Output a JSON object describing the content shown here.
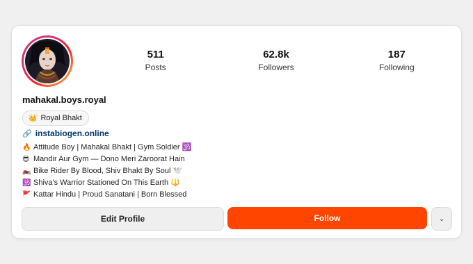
{
  "profile": {
    "username": "mahakal.boys.royal",
    "badge": {
      "icon": "crown-icon",
      "glyph": "👑",
      "label": "Royal Bhakt"
    },
    "link": {
      "icon": "link-icon",
      "glyph": "🔗",
      "text": "instabiogen.online"
    },
    "avatar": {
      "icon": "profile-avatar",
      "ring_colors": [
        "#c13584",
        "#fd1d1d",
        "#fcaf45"
      ]
    }
  },
  "stats": [
    {
      "value": "511",
      "label": "Posts"
    },
    {
      "value": "62.8k",
      "label": "Followers"
    },
    {
      "value": "187",
      "label": "Following"
    }
  ],
  "bio": [
    {
      "emoji": "🔥",
      "text": "Attitude Boy | Mahakal Bhakt | Gym Soldier 🕉️"
    },
    {
      "emoji": "😎",
      "text": "Mandir Aur Gym — Dono Meri Zaroorat Hain"
    },
    {
      "emoji": "🏍️",
      "text": "Bike Rider By Blood, Shiv Bhakt By Soul 🕊️"
    },
    {
      "emoji": "🕉️",
      "text": "Shiva's Warrior Stationed On This Earth 🔱"
    },
    {
      "emoji": "🚩",
      "text": "Kattar Hindu | Proud Sanatani | Born Blessed"
    }
  ],
  "actions": {
    "edit_label": "Edit Profile",
    "follow_label": "Follow",
    "more_label": "⌄",
    "follow_color": "#ff4500"
  }
}
